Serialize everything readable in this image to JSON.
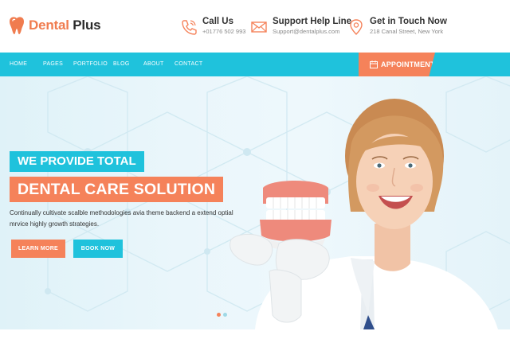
{
  "brand": {
    "name_primary": "Dental",
    "name_secondary": " Plus"
  },
  "contacts": [
    {
      "icon": "phone-icon",
      "title": "Call Us",
      "sub": "+01776 502 993"
    },
    {
      "icon": "envelope-icon",
      "title": "Support Help Line",
      "sub": "Support@dentalplus.com"
    },
    {
      "icon": "map-pin-icon",
      "title": "Get in Touch Now",
      "sub": "218 Canal Street, New York"
    }
  ],
  "nav": {
    "items": [
      "HOME",
      "PAGES",
      "PORTFOLIO",
      "BLOG",
      "ABOUT",
      "CONTACT"
    ]
  },
  "appointment": {
    "label": "APPOINTMENT"
  },
  "hero": {
    "line1": "WE PROVIDE TOTAL",
    "line2": "DENTAL CARE SOLUTION",
    "description": "Continually cultivate scalble methodologies avia theme backend a extend optial mrvice highly growth strategies.",
    "learn_more": "LEARN MORE",
    "book_now": "BOOK NOW"
  },
  "colors": {
    "accent_orange": "#f5825a",
    "accent_cyan": "#1fc2dc",
    "text_dark": "#333333"
  }
}
